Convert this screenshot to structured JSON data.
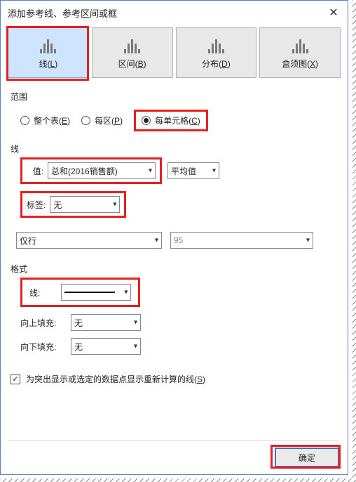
{
  "title": "添加参考线、参考区间或框",
  "tabs": [
    {
      "label": "线",
      "key": "L"
    },
    {
      "label": "区间",
      "key": "B"
    },
    {
      "label": "分布",
      "key": "D"
    },
    {
      "label": "盒须图",
      "key": "X"
    }
  ],
  "sections": {
    "scope": {
      "label": "范围"
    },
    "line": {
      "label": "线"
    },
    "format": {
      "label": "格式"
    }
  },
  "scope_options": [
    {
      "label": "整个表",
      "key": "E",
      "checked": false
    },
    {
      "label": "每区",
      "key": "P",
      "checked": false
    },
    {
      "label": "每单元格",
      "key": "C",
      "checked": true
    }
  ],
  "line_fields": {
    "value_label": "值:",
    "value_select": "总和(2016销售额)",
    "agg_select": "平均值",
    "label_label": "标签:",
    "label_select": "无",
    "row_select": "仅行",
    "number_value": "95"
  },
  "format_fields": {
    "line_label": "线:",
    "fill_up_label": "向上填充:",
    "fill_up_value": "无",
    "fill_down_label": "向下填充:",
    "fill_down_value": "无"
  },
  "recalc_checkbox": {
    "label": "为突出显示或选定的数据点显示重新计算的线",
    "key": "S",
    "checked": true
  },
  "buttons": {
    "ok": "确定"
  }
}
